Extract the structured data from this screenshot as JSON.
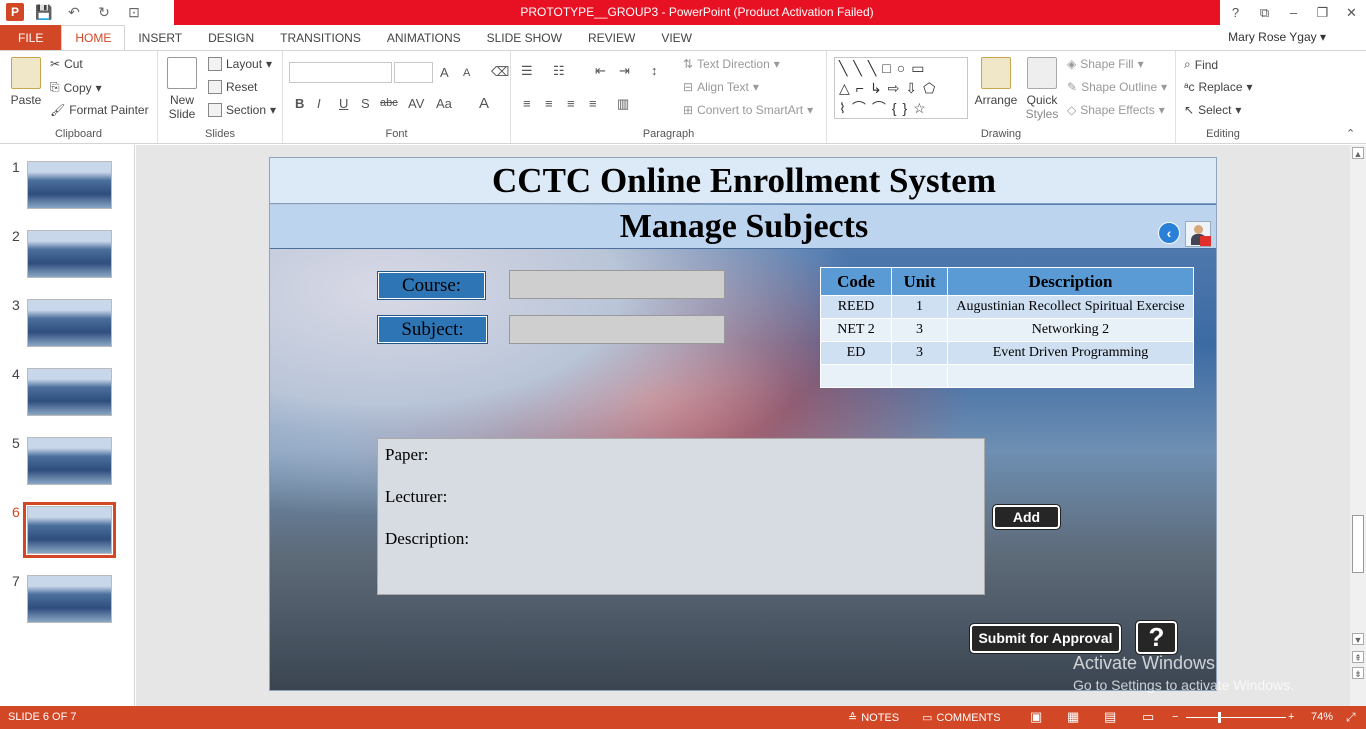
{
  "window": {
    "title": "PROTOTYPE__GROUP3 -  PowerPoint (Product Activation Failed)",
    "help": "?",
    "controls": [
      "restore-ribbon",
      "minimize",
      "restore",
      "close"
    ]
  },
  "ribbon": {
    "tabs": [
      "FILE",
      "HOME",
      "INSERT",
      "DESIGN",
      "TRANSITIONS",
      "ANIMATIONS",
      "SLIDE SHOW",
      "REVIEW",
      "VIEW"
    ],
    "active_tab": "HOME",
    "user": "Mary Rose Ygay",
    "clipboard": {
      "paste": "Paste",
      "cut": "Cut",
      "copy": "Copy",
      "format_painter": "Format Painter",
      "label": "Clipboard"
    },
    "slides": {
      "new_slide_1": "New",
      "new_slide_2": "Slide",
      "layout": "Layout",
      "reset": "Reset",
      "section": "Section",
      "label": "Slides"
    },
    "font": {
      "label": "Font",
      "bold": "B",
      "italic": "I",
      "underline": "U",
      "shadow": "S",
      "strike": "abc",
      "spacing": "AV",
      "case": "Aa",
      "color": "A",
      "grow": "A",
      "shrink": "A"
    },
    "paragraph": {
      "text_direction": "Text Direction",
      "align_text": "Align Text",
      "convert_smartart": "Convert to SmartArt",
      "label": "Paragraph"
    },
    "drawing": {
      "arrange": "Arrange",
      "quick_styles_1": "Quick",
      "quick_styles_2": "Styles",
      "shape_fill": "Shape Fill",
      "shape_outline": "Shape Outline",
      "shape_effects": "Shape Effects",
      "label": "Drawing"
    },
    "editing": {
      "find": "Find",
      "replace": "Replace",
      "select": "Select",
      "label": "Editing"
    }
  },
  "thumbnails": {
    "numbers": [
      "1",
      "2",
      "3",
      "4",
      "5",
      "6",
      "7"
    ],
    "selected": "6"
  },
  "slide": {
    "title": "CCTC Online Enrollment System",
    "subtitle": "Manage Subjects",
    "course_label": "Course:",
    "subject_label": "Subject:",
    "course_value": "",
    "subject_value": "",
    "table": {
      "headers": [
        "Code",
        "Unit",
        "Description"
      ],
      "rows": [
        [
          "REED",
          "1",
          "Augustinian Recollect Spiritual Exercise"
        ],
        [
          "NET 2",
          "3",
          "Networking 2"
        ],
        [
          "ED",
          "3",
          "Event Driven Programming"
        ],
        [
          "",
          "",
          ""
        ]
      ]
    },
    "details": {
      "paper": "Paper:",
      "lecturer": "Lecturer:",
      "description": "Description:"
    },
    "add_button": "Add",
    "submit_button": "Submit for Approval",
    "help_button": "?"
  },
  "watermark": {
    "line1": "Activate Windows",
    "line2": "Go to Settings to activate Windows."
  },
  "statusbar": {
    "slide_info": "SLIDE 6 OF 7",
    "notes": "NOTES",
    "comments": "COMMENTS",
    "zoom": "74%"
  },
  "colors": {
    "accent": "#d24726",
    "titlebar_red": "#e81123",
    "label_blue": "#2e75b6",
    "table_header": "#5b9bd5"
  }
}
